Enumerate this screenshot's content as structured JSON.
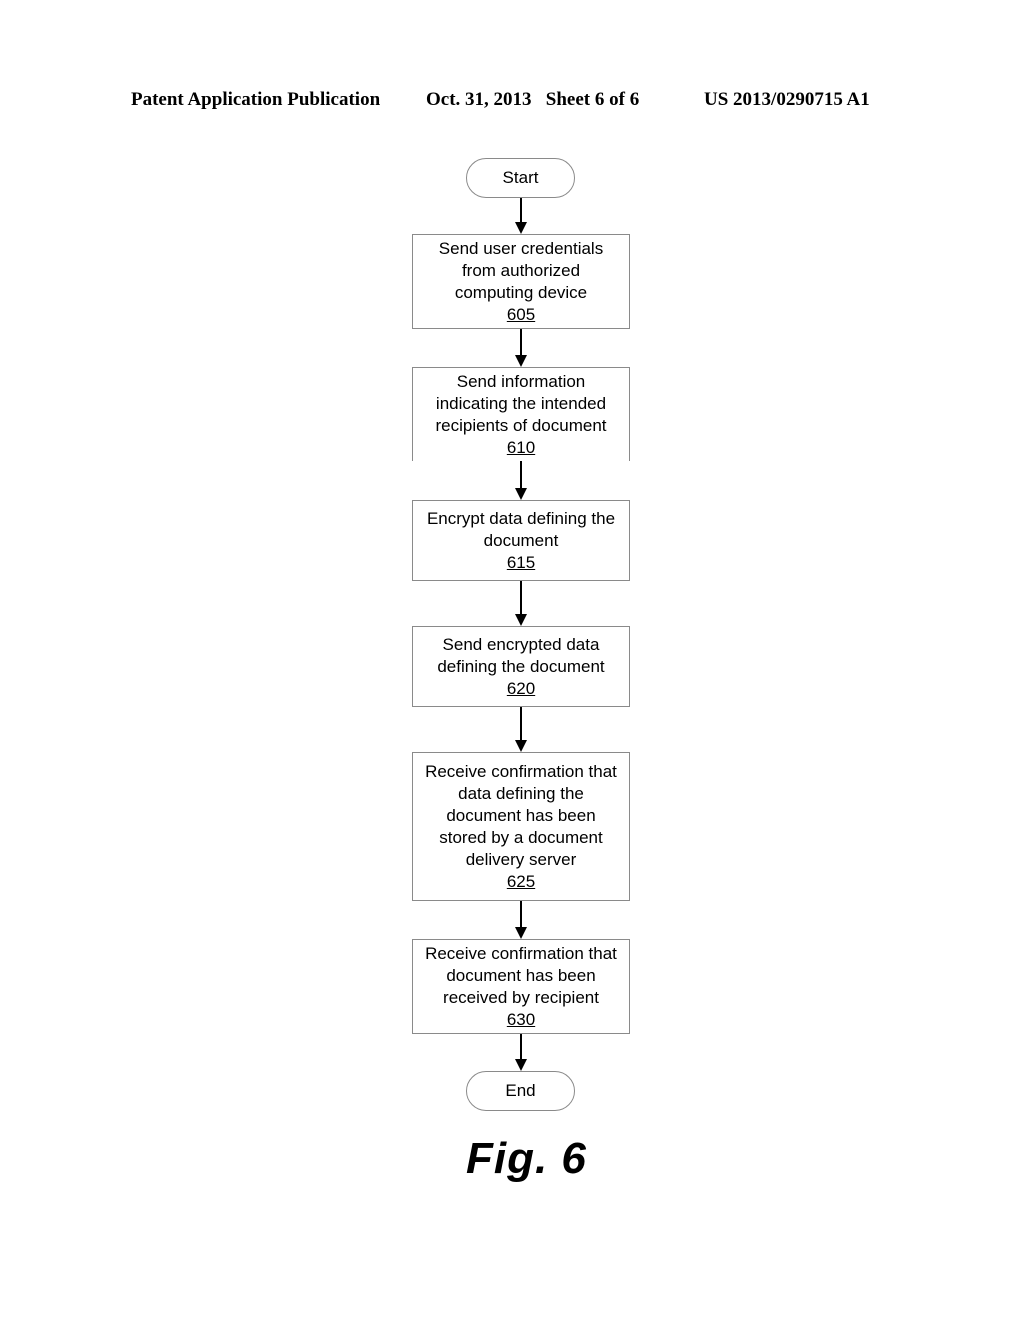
{
  "header": {
    "left": "Patent Application Publication",
    "middle": "Oct. 31, 2013   Sheet 6 of 6",
    "right": "US 2013/0290715 A1"
  },
  "flowchart": {
    "start": "Start",
    "end": "End",
    "steps": [
      {
        "lines": [
          "Send user credentials",
          "from authorized",
          "computing device"
        ],
        "ref": "605"
      },
      {
        "lines": [
          "Send information",
          "indicating the intended",
          "recipients of document"
        ],
        "ref": "610"
      },
      {
        "lines": [
          "Encrypt data defining the",
          "document"
        ],
        "ref": "615"
      },
      {
        "lines": [
          "Send encrypted data",
          "defining the document"
        ],
        "ref": "620"
      },
      {
        "lines": [
          "Receive confirmation that",
          "data defining the",
          "document has been",
          "stored by a document",
          "delivery server"
        ],
        "ref": "625"
      },
      {
        "lines": [
          "Receive confirmation that",
          "document has been",
          "received by recipient"
        ],
        "ref": "630"
      }
    ]
  },
  "figure_label": "Fig. 6"
}
